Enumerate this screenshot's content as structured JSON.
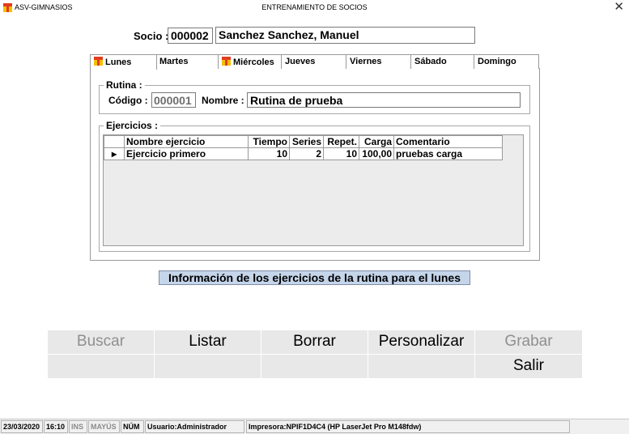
{
  "window": {
    "app_name": "ASV-GIMNASIOS",
    "title": "ENTRENAMIENTO DE SOCIOS",
    "close_glyph": "✕"
  },
  "socio": {
    "label": "Socio :",
    "code": "000002",
    "name": "Sanchez Sanchez, Manuel"
  },
  "tabs": [
    {
      "label": "Lunes",
      "active": true,
      "icon": "flag-icon"
    },
    {
      "label": "Martes"
    },
    {
      "label": "Miércoles",
      "icon": "flag-icon"
    },
    {
      "label": "Jueves"
    },
    {
      "label": "Viernes"
    },
    {
      "label": "Sábado"
    },
    {
      "label": "Domingo"
    }
  ],
  "rutina": {
    "group_title": "Rutina :",
    "codigo_label": "Código :",
    "codigo": "000001",
    "nombre_label": "Nombre :",
    "nombre": "Rutina de prueba"
  },
  "ejercicios": {
    "group_title": "Ejercicios :",
    "columns": [
      "Nombre ejercicio",
      "Tiempo",
      "Series",
      "Repet.",
      "Carga",
      "Comentario"
    ],
    "rows": [
      {
        "indicator": "▸",
        "nombre": "Ejercicio primero",
        "tiempo": "10",
        "series": "2",
        "repet": "10",
        "carga": "100,00",
        "comentario": "pruebas carga"
      }
    ]
  },
  "info_text": "Información de los ejercicios de la rutina para el lunes",
  "buttons": {
    "buscar": "Buscar",
    "listar": "Listar",
    "borrar": "Borrar",
    "personalizar": "Personalizar",
    "grabar": "Grabar",
    "salir": "Salir"
  },
  "statusbar": {
    "date": "23/03/2020",
    "time": "16:10",
    "ins": "INS",
    "mayus": "MAYÚS",
    "num": "NÚM",
    "usuario": "Usuario:Administrador",
    "impresora": "Impresora:NPIF1D4C4 (HP LaserJet Pro M148fdw)"
  },
  "colors": {
    "info_background": "#c5d5ea",
    "button_background": "#e8e8e8",
    "disabled_text": "#8f8f8f"
  }
}
